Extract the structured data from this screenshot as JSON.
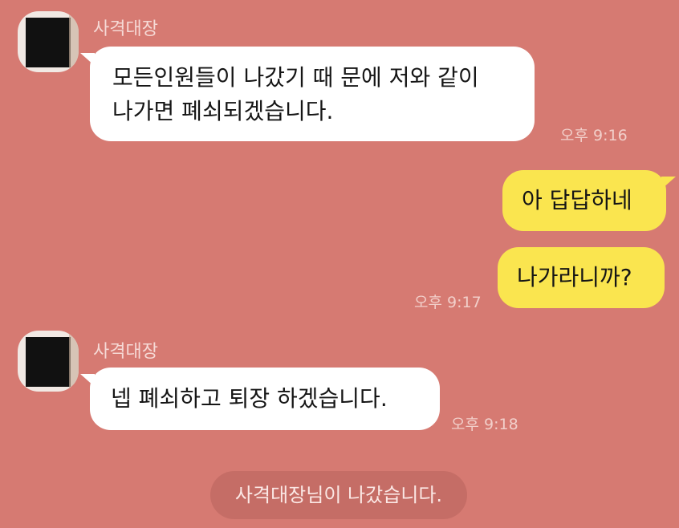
{
  "messages": [
    {
      "sender": "사격대장",
      "lines": [
        "모든인원들이 나갔기 때 문에  저와 같이",
        "나가면 폐쇠되겠습니다."
      ],
      "time": "오후 9:16"
    },
    {
      "text": "아 답답하네"
    },
    {
      "text": "나가라니까?",
      "time": "오후 9:17"
    },
    {
      "sender": "사격대장",
      "text": "넵 폐쇠하고 퇴장 하겠습니다.",
      "time": "오후 9:18"
    }
  ],
  "system_notice": "사격대장님이 나갔습니다.",
  "colors": {
    "background": "#d67a72",
    "incoming_bubble": "#ffffff",
    "outgoing_bubble": "#fae54f"
  }
}
